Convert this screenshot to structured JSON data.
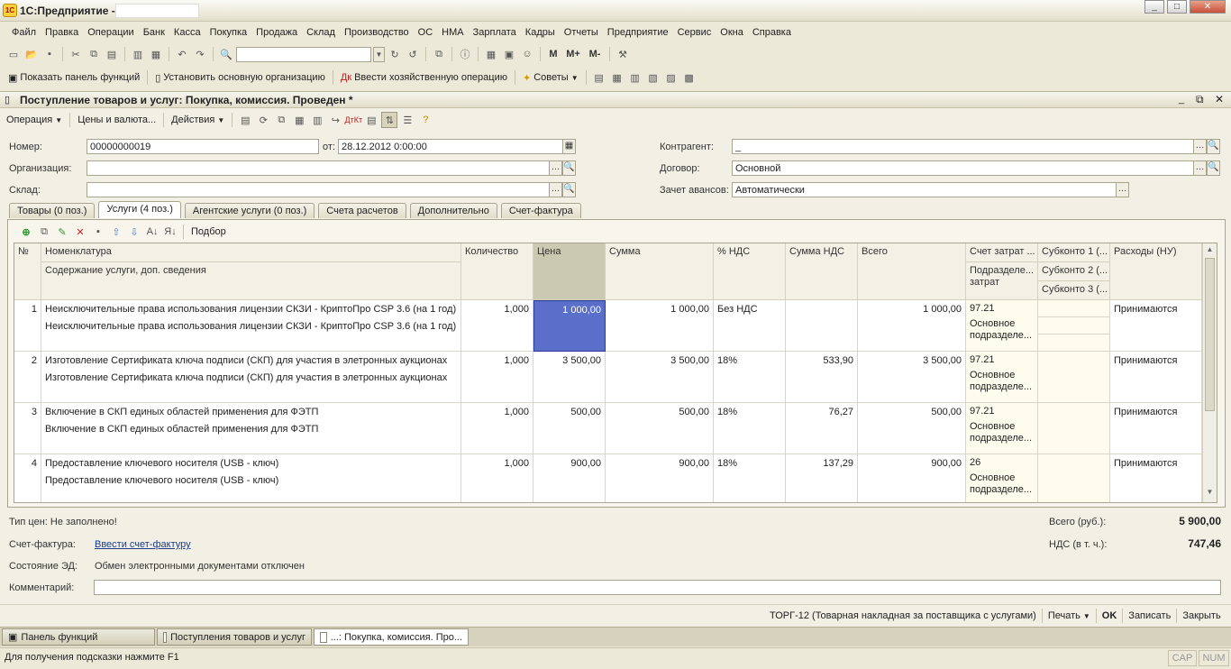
{
  "app": {
    "title": "1С:Предприятие - ",
    "logo_text": "1С"
  },
  "window_buttons": [
    "_",
    "□",
    "✕"
  ],
  "menu": [
    "Файл",
    "Правка",
    "Операции",
    "Банк",
    "Касса",
    "Покупка",
    "Продажа",
    "Склад",
    "Производство",
    "ОС",
    "НМА",
    "Зарплата",
    "Кадры",
    "Отчеты",
    "Предприятие",
    "Сервис",
    "Окна",
    "Справка"
  ],
  "toolbar2": {
    "show_panel": "Показать панель функций",
    "set_org": "Установить основную организацию",
    "enter_op": "Ввести хозяйственную операцию",
    "tips": "Советы"
  },
  "doc": {
    "title": "Поступление товаров и услуг: Покупка, комиссия. Проведен *",
    "buttons": [
      "_",
      "⧉",
      "✕"
    ],
    "actions": {
      "operation": "Операция",
      "prices": "Цены и валюта...",
      "actions": "Действия",
      "help": "?"
    }
  },
  "form": {
    "number_label": "Номер:",
    "number": "00000000019",
    "from_label": "от:",
    "date": "28.12.2012  0:00:00",
    "org_label": "Организация:",
    "org": "",
    "warehouse_label": "Склад:",
    "warehouse": "",
    "counterparty_label": "Контрагент:",
    "counterparty": "_",
    "contract_label": "Договор:",
    "contract": "Основной",
    "advance_label": "Зачет авансов:",
    "advance": "Автоматически"
  },
  "tabs": [
    "Товары (0 поз.)",
    "Услуги (4 поз.)",
    "Агентские услуги (0 поз.)",
    "Счета расчетов",
    "Дополнительно",
    "Счет-фактура"
  ],
  "grid_toolbar": {
    "select": "Подбор"
  },
  "grid": {
    "headers": {
      "n": "№",
      "nomenclature": "Номенклатура",
      "content": "Содержание услуги, доп. сведения",
      "qty": "Количество",
      "price": "Цена",
      "sum": "Сумма",
      "vat_rate": "% НДС",
      "vat_sum": "Сумма НДС",
      "total": "Всего",
      "account": "Счет затрат ...",
      "division": "Подразделе... затрат",
      "sub1": "Субконто 1 (...",
      "sub2": "Субконто 2 (...",
      "sub3": "Субконто 3 (...",
      "expenses": "Расходы (НУ)"
    },
    "rows": [
      {
        "n": "1",
        "name": "Неисключительные права использования лицензии СКЗИ - КриптоПро CSP 3.6 (на 1 год)",
        "content": "Неисключительные права использования лицензии СКЗИ - КриптоПро CSP 3.6 (на 1 год)",
        "qty": "1,000",
        "price": "1 000,00",
        "sum": "1 000,00",
        "vat": "Без НДС",
        "vat_sum": "",
        "total": "1 000,00",
        "account": "97.21",
        "division1": "Основное",
        "division2": "подразделе...",
        "expenses": "Принимаются"
      },
      {
        "n": "2",
        "name": "Изготовление Сертификата ключа подписи (СКП) для участия в элетронных аукционах",
        "content": "Изготовление Сертификата ключа подписи (СКП) для участия в элетронных аукционах",
        "qty": "1,000",
        "price": "3 500,00",
        "sum": "3 500,00",
        "vat": "18%",
        "vat_sum": "533,90",
        "total": "3 500,00",
        "account": "97.21",
        "division1": "Основное",
        "division2": "подразделе...",
        "expenses": "Принимаются"
      },
      {
        "n": "3",
        "name": "Включение в СКП единых областей применения для ФЭТП",
        "content": "Включение в СКП единых областей применения для ФЭТП",
        "qty": "1,000",
        "price": "500,00",
        "sum": "500,00",
        "vat": "18%",
        "vat_sum": "76,27",
        "total": "500,00",
        "account": "97.21",
        "division1": "Основное",
        "division2": "подразделе...",
        "expenses": "Принимаются"
      },
      {
        "n": "4",
        "name": "Предоставление ключевого носителя (USB - ключ)",
        "content": "Предоставление ключевого носителя (USB - ключ)",
        "qty": "1,000",
        "price": "900,00",
        "sum": "900,00",
        "vat": "18%",
        "vat_sum": "137,29",
        "total": "900,00",
        "account": "26",
        "division1": "Основное",
        "division2": "подразделе...",
        "expenses": "Принимаются"
      }
    ]
  },
  "footer": {
    "price_type": "Тип цен: Не заполнено!",
    "total_label": "Всего (руб.):",
    "total": "5 900,00",
    "invoice_label": "Счет-фактура:",
    "invoice_link": "Ввести счет-фактуру",
    "vat_label": "НДС (в т. ч.):",
    "vat": "747,46",
    "ed_label": "Состояние ЭД:",
    "ed_value": "Обмен электронными документами отключен",
    "comment_label": "Комментарий:",
    "comment": "",
    "torg": "ТОРГ-12 (Товарная накладная за поставщика с услугами)",
    "print": "Печать",
    "ok": "OK",
    "save": "Записать",
    "close": "Закрыть"
  },
  "taskbar": [
    "Панель функций",
    "Поступления товаров и услуг",
    "...: Покупка, комиссия. Про..."
  ],
  "status": {
    "hint": "Для получения подсказки нажмите F1",
    "cap": "CAP",
    "num": "NUM"
  }
}
